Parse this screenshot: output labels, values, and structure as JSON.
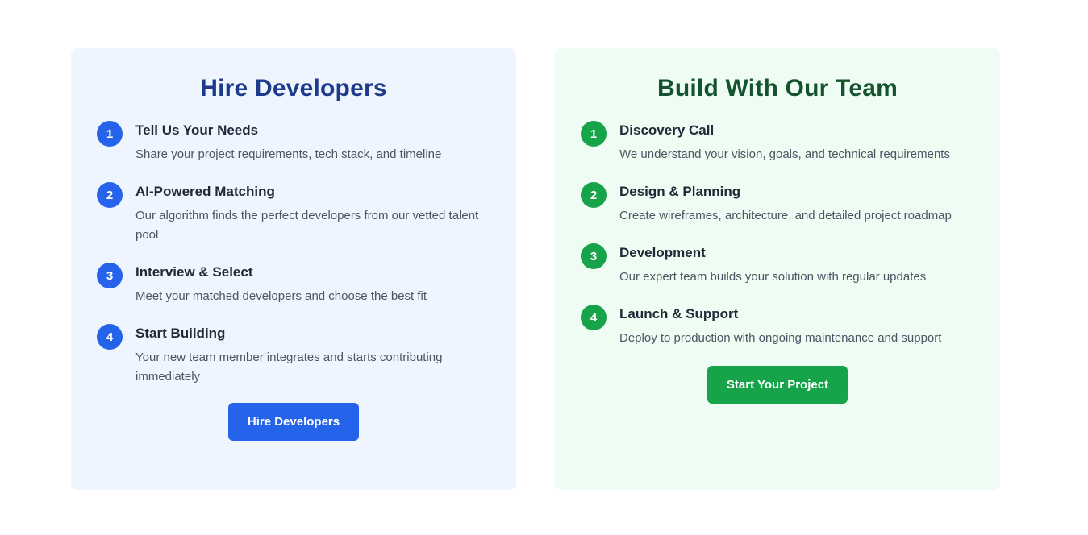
{
  "hire": {
    "title": "Hire Developers",
    "steps": [
      {
        "num": "1",
        "title": "Tell Us Your Needs",
        "desc": "Share your project requirements, tech stack, and timeline"
      },
      {
        "num": "2",
        "title": "AI-Powered Matching",
        "desc": "Our algorithm finds the perfect developers from our vetted talent pool"
      },
      {
        "num": "3",
        "title": "Interview & Select",
        "desc": "Meet your matched developers and choose the best fit"
      },
      {
        "num": "4",
        "title": "Start Building",
        "desc": "Your new team member integrates and starts contributing immediately"
      }
    ],
    "button_label": "Hire Developers",
    "accent": "#2563eb"
  },
  "build": {
    "title": "Build With Our Team",
    "steps": [
      {
        "num": "1",
        "title": "Discovery Call",
        "desc": "We understand your vision, goals, and technical requirements"
      },
      {
        "num": "2",
        "title": "Design & Planning",
        "desc": "Create wireframes, architecture, and detailed project roadmap"
      },
      {
        "num": "3",
        "title": "Development",
        "desc": "Our expert team builds your solution with regular updates"
      },
      {
        "num": "4",
        "title": "Launch & Support",
        "desc": "Deploy to production with ongoing maintenance and support"
      }
    ],
    "button_label": "Start Your Project",
    "accent": "#16a34a"
  }
}
